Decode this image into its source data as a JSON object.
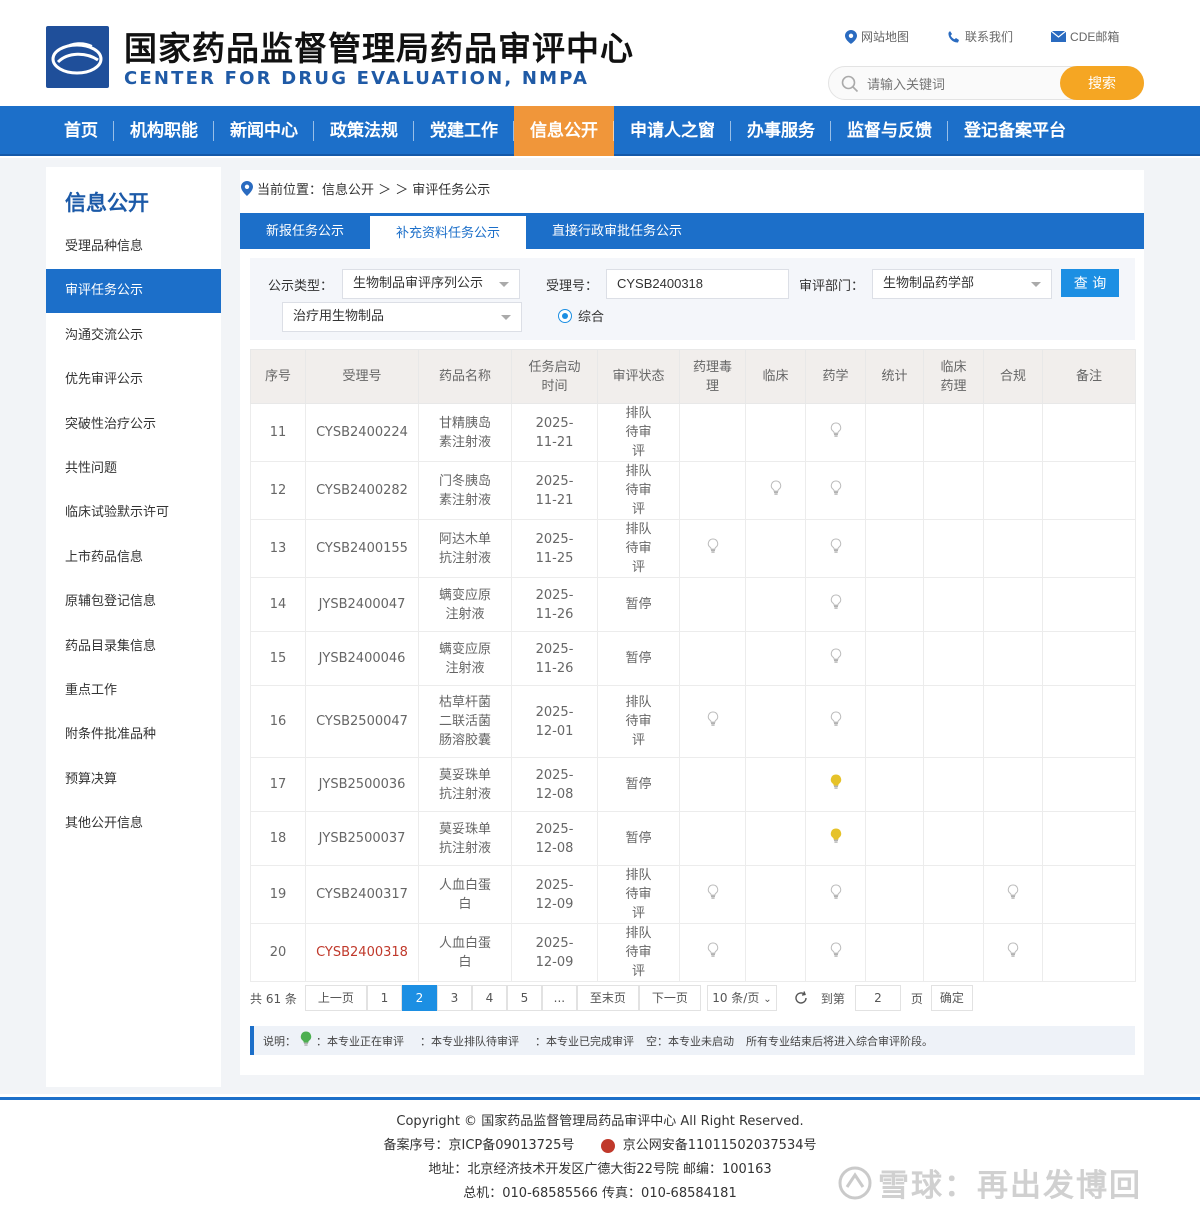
{
  "header": {
    "title_cn": "国家药品监督管理局药品审评中心",
    "title_en": "CENTER FOR DRUG EVALUATION, NMPA",
    "links": [
      {
        "label": "网站地图",
        "icon": "map-pin-icon"
      },
      {
        "label": "联系我们",
        "icon": "phone-icon"
      },
      {
        "label": "CDE邮箱",
        "icon": "mail-icon"
      }
    ],
    "search_placeholder": "请输入关键词",
    "search_button": "搜索"
  },
  "nav": {
    "items": [
      "首页",
      "机构职能",
      "新闻中心",
      "政策法规",
      "党建工作",
      "信息公开",
      "申请人之窗",
      "办事服务",
      "监督与反馈",
      "登记备案平台"
    ],
    "active_index": 5
  },
  "sidebar": {
    "title": "信息公开",
    "items": [
      "受理品种信息",
      "审评任务公示",
      "沟通交流公示",
      "优先审评公示",
      "突破性治疗公示",
      "共性问题",
      "临床试验默示许可",
      "上市药品信息",
      "原辅包登记信息",
      "药品目录集信息",
      "重点工作",
      "附条件批准品种",
      "预算决算",
      "其他公开信息"
    ],
    "active_index": 1
  },
  "breadcrumb": {
    "prefix": "当前位置：信息公开 ＞ ＞",
    "current": "审评任务公示"
  },
  "tabs": [
    "新报任务公示",
    "补充资料任务公示",
    "直接行政审批任务公示"
  ],
  "filter": {
    "type_label": "公示类型：",
    "type_value": "生物制品审评序列公示",
    "sub_type_value": "治疗用生物制品",
    "accept_label": "受理号：",
    "accept_value": "CYSB2400318",
    "dept_label": "审评部门：",
    "dept_value": "生物制品药学部",
    "query_button": "查 询",
    "radio_label": "综合"
  },
  "table": {
    "headers": [
      "序号",
      "受理号",
      "药品名称",
      "任务启动时间",
      "审评状态",
      "药理毒理",
      "临床",
      "药学",
      "统计",
      "临床药理",
      "合规",
      "备注"
    ],
    "rows": [
      {
        "no": "11",
        "accept": "CYSB2400224",
        "name": "甘精胰岛素注射液",
        "date": "2025-11-21",
        "status": "排队待审评",
        "pharm": "",
        "clinical": "",
        "cmc": "done",
        "stat": "",
        "cp": "",
        "comp": "",
        "note": ""
      },
      {
        "no": "12",
        "accept": "CYSB2400282",
        "name": "门冬胰岛素注射液",
        "date": "2025-11-21",
        "status": "排队待审评",
        "pharm": "",
        "clinical": "done",
        "cmc": "done",
        "stat": "",
        "cp": "",
        "comp": "",
        "note": ""
      },
      {
        "no": "13",
        "accept": "CYSB2400155",
        "name": "阿达木单抗注射液",
        "date": "2025-11-25",
        "status": "排队待审评",
        "pharm": "done",
        "clinical": "",
        "cmc": "done",
        "stat": "",
        "cp": "",
        "comp": "",
        "note": ""
      },
      {
        "no": "14",
        "accept": "JYSB2400047",
        "name": "螨变应原注射液",
        "date": "2025-11-26",
        "status": "暂停",
        "pharm": "",
        "clinical": "",
        "cmc": "done",
        "stat": "",
        "cp": "",
        "comp": "",
        "note": ""
      },
      {
        "no": "15",
        "accept": "JYSB2400046",
        "name": "螨变应原注射液",
        "date": "2025-11-26",
        "status": "暂停",
        "pharm": "",
        "clinical": "",
        "cmc": "done",
        "stat": "",
        "cp": "",
        "comp": "",
        "note": ""
      },
      {
        "no": "16",
        "accept": "CYSB2500047",
        "name": "枯草杆菌二联活菌肠溶胶囊",
        "date": "2025-12-01",
        "status": "排队待审评",
        "pharm": "done",
        "clinical": "",
        "cmc": "done",
        "stat": "",
        "cp": "",
        "comp": "",
        "note": ""
      },
      {
        "no": "17",
        "accept": "JYSB2500036",
        "name": "莫妥珠单抗注射液",
        "date": "2025-12-08",
        "status": "暂停",
        "pharm": "",
        "clinical": "",
        "cmc": "queued",
        "stat": "",
        "cp": "",
        "comp": "",
        "note": ""
      },
      {
        "no": "18",
        "accept": "JYSB2500037",
        "name": "莫妥珠单抗注射液",
        "date": "2025-12-08",
        "status": "暂停",
        "pharm": "",
        "clinical": "",
        "cmc": "queued",
        "stat": "",
        "cp": "",
        "comp": "",
        "note": ""
      },
      {
        "no": "19",
        "accept": "CYSB2400317",
        "name": "人血白蛋白",
        "date": "2025-12-09",
        "status": "排队待审评",
        "pharm": "done",
        "clinical": "",
        "cmc": "done",
        "stat": "",
        "cp": "",
        "comp": "done",
        "note": ""
      },
      {
        "no": "20",
        "accept": "CYSB2400318",
        "name": "人血白蛋白",
        "date": "2025-12-09",
        "status": "排队待审评",
        "pharm": "done",
        "clinical": "",
        "cmc": "done",
        "stat": "",
        "cp": "",
        "comp": "done",
        "note": "",
        "highlight": true
      }
    ]
  },
  "pager": {
    "total": "共 61 条",
    "prev": "上一页",
    "pages": [
      "1",
      "2",
      "3",
      "4",
      "5",
      "..."
    ],
    "current": "2",
    "last": "至末页",
    "next": "下一页",
    "page_size": "10 条/页",
    "goto_label": "到第",
    "goto_value": "2",
    "page_unit": "页",
    "confirm": "确定"
  },
  "legend": {
    "prefix": "说明：",
    "active": "：本专业正在审评",
    "queued": "：本专业排队待审评",
    "done": "：本专业已完成审评",
    "empty": "空：本专业未启动",
    "note": "所有专业结束后将进入综合审评阶段。"
  },
  "footer": {
    "copyright": "Copyright © 国家药品监督管理局药品审评中心   All Right Reserved.",
    "icp": "备案序号：京ICP备09013725号",
    "police": "京公网安备11011502037534号",
    "address": "地址：北京经济技术开发区广德大街22号院     邮编：100163",
    "phone": "总机：010-68585566     传真：010-68584181"
  },
  "watermark": "雪球：再出发博回",
  "colors": {
    "primary": "#1c6fc9",
    "accent": "#f0963a",
    "search": "#f5a623",
    "bulb_queued": "#e6c229",
    "bulb_active": "#4caf50",
    "bulb_done": "#cfcfcf"
  }
}
